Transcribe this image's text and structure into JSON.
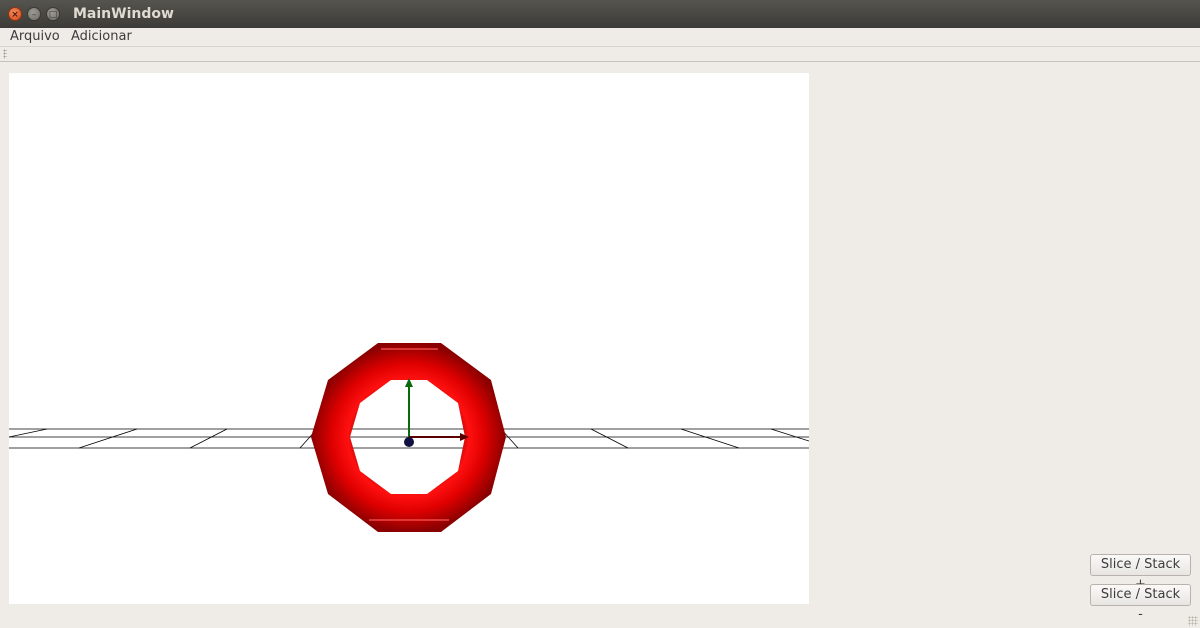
{
  "window": {
    "title": "MainWindow"
  },
  "menubar": {
    "items": [
      {
        "label": "Arquivo"
      },
      {
        "label": "Adicionar"
      }
    ]
  },
  "viewport": {
    "object": "torus",
    "object_color": "#e00000",
    "background": "#ffffff"
  },
  "buttons": {
    "slice_stack_plus": "Slice / Stack +",
    "slice_stack_minus": "Slice / Stack -"
  }
}
